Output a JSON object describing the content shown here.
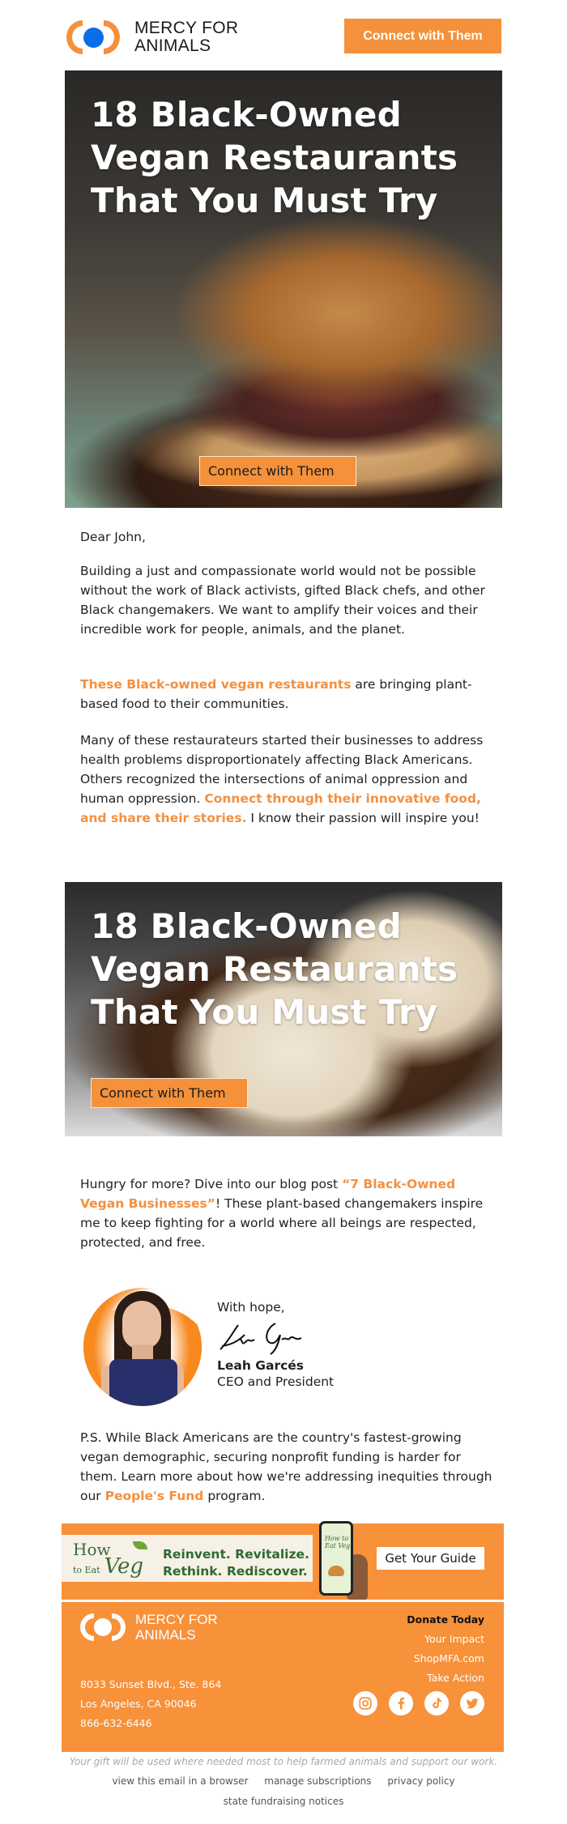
{
  "header": {
    "logo_line1": "MERCY FOR",
    "logo_line2": "ANIMALS",
    "cta_label": "Connect with Them"
  },
  "hero1": {
    "title_line1": "18 Black-Owned",
    "title_line2": "Vegan Restaurants",
    "title_line3": "That You Must Try",
    "cta_label": "Connect with Them",
    "image_desc": "vegan burger on wooden board"
  },
  "body": {
    "greeting": "Dear John,",
    "p1": "Building a just and compassionate world would not be possible without the work of Black activists, gifted Black chefs, and other Black changemakers. We want to amplify their voices and their incredible work for people, animals, and the planet.",
    "p2_link": "These Black-owned vegan restaurants",
    "p2_rest": " are bringing plant-based food to their communities.",
    "p3_start": "Many of these restaurateurs started their businesses to address health problems disproportionately affecting Black Americans. Others recognized the intersections of animal oppression and human oppression. ",
    "p3_link": "Connect through their innovative food, and share their stories.",
    "p3_end": " I know their passion will inspire you!"
  },
  "hero2": {
    "title_line1": "18 Black-Owned",
    "title_line2": "Vegan Restaurants",
    "title_line3": "That You Must Try",
    "cta_label": "Connect with Them",
    "image_desc": "tacos with beans and avocado on wooden board"
  },
  "body2": {
    "p4_start": "Hungry for more? Dive into our blog post ",
    "p4_link": "“7 Black-Owned Vegan Businesses”",
    "p4_end": "! These plant-based changemakers inspire me to keep fighting for a world where all beings are respected, protected, and free."
  },
  "signature": {
    "closing": "With hope,",
    "name": "Leah Garcés",
    "title": "CEO and President"
  },
  "ps": {
    "text_start": "P.S. While Black Americans are the country's fastest-growing vegan demographic, securing nonprofit funding is harder for them. Learn more about how we're addressing inequities through our ",
    "link": "People's Fund",
    "text_end": " program."
  },
  "promo": {
    "brand_how": "How",
    "brand_to_eat": "to Eat",
    "brand_veg": "Veg",
    "tagline_1": "Reinvent. Revitalize.",
    "tagline_2": "Rethink. Rediscover.",
    "cta_label": "Get Your Guide"
  },
  "footer": {
    "logo_line1": "MERCY FOR",
    "logo_line2": "ANIMALS",
    "address_1": "8033 Sunset Blvd., Ste. 864",
    "address_2": "Los Angeles, CA 90046",
    "phone": "866-632-6446",
    "links": [
      "Donate Today",
      "Your Impact",
      "ShopMFA.com",
      "Take Action"
    ],
    "socials": [
      "instagram-icon",
      "facebook-icon",
      "tiktok-icon",
      "twitter-icon"
    ]
  },
  "legal": {
    "gift_note": "Your gift will be used where needed most to help farmed animals and support our work.",
    "links": [
      "view this email in a browser",
      "manage subscriptions",
      "privacy policy",
      "state fundraising notices"
    ]
  },
  "colors": {
    "brand_orange": "#f4913a",
    "brand_blue": "#0a6ee6",
    "link_orange": "#f39040"
  }
}
